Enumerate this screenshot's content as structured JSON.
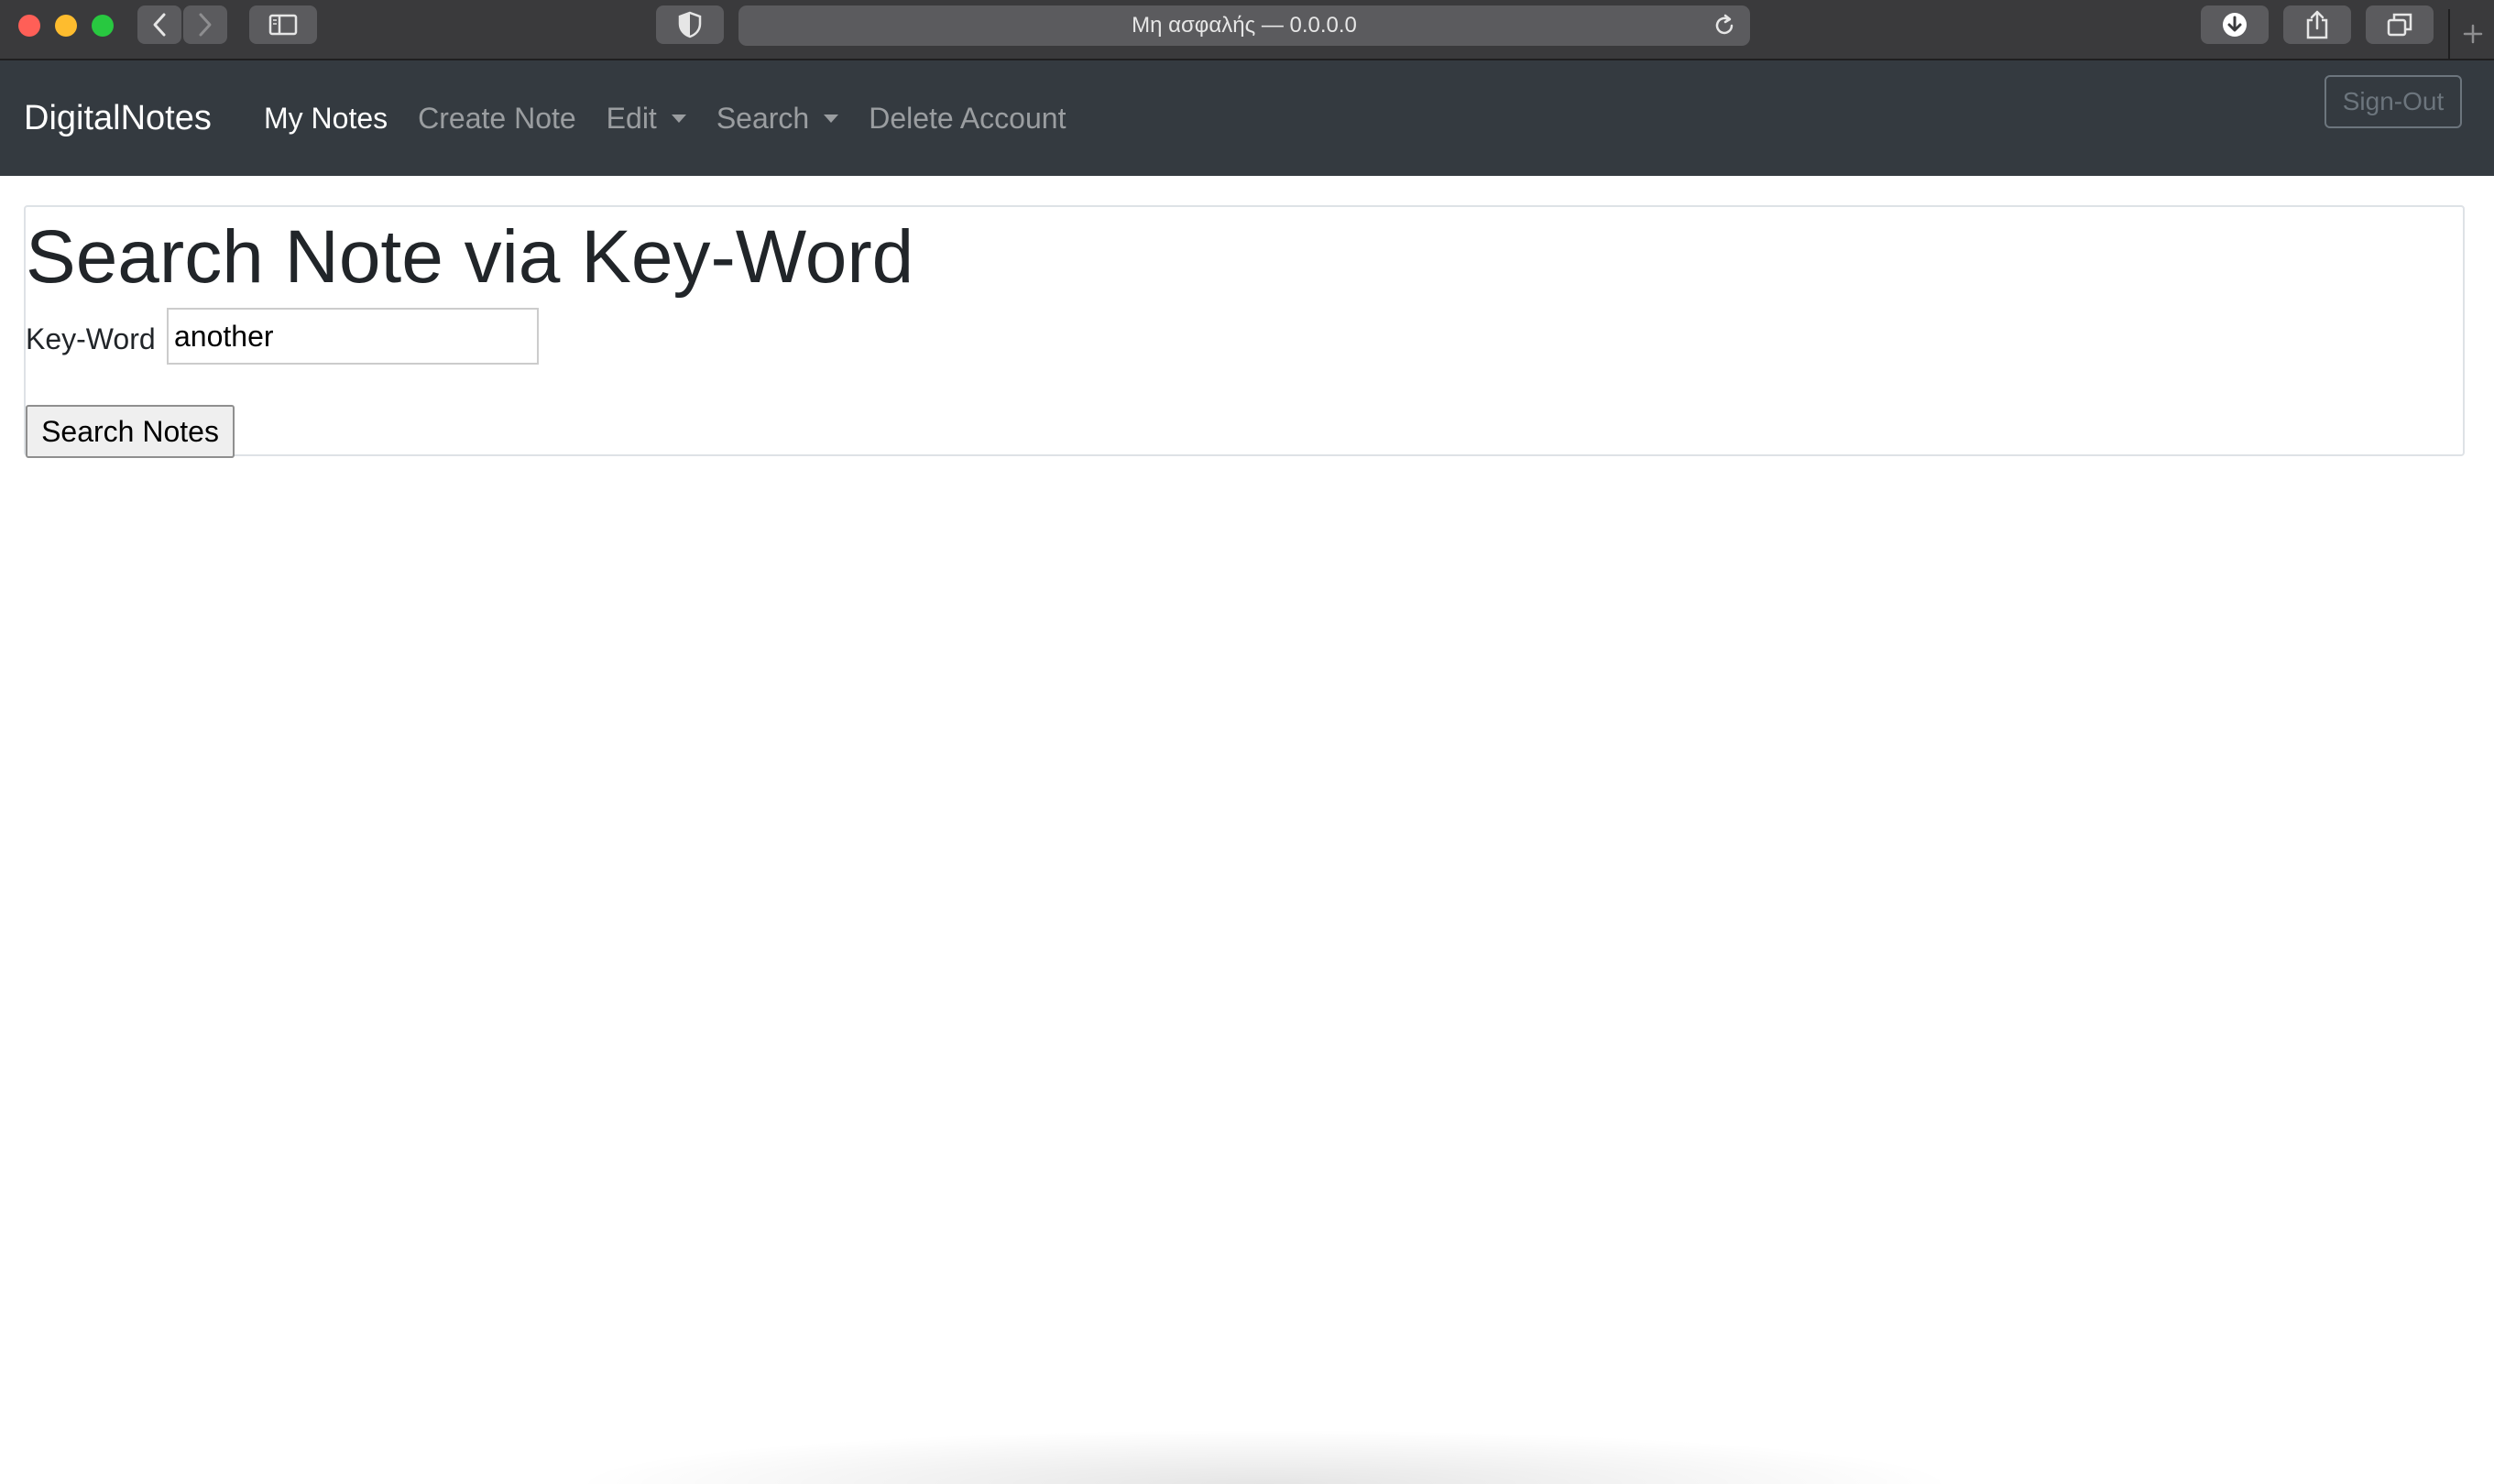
{
  "browser": {
    "address_text": "Μη ασφαλής — 0.0.0.0"
  },
  "navbar": {
    "brand": "DigitalNotes",
    "links": [
      {
        "label": "My Notes",
        "active": true
      },
      {
        "label": "Create Note"
      },
      {
        "label": "Edit",
        "dropdown": true
      },
      {
        "label": "Search",
        "dropdown": true
      },
      {
        "label": "Delete Account"
      }
    ],
    "signout_label": "Sign-Out"
  },
  "main": {
    "title": "Search Note via Key-Word",
    "keyword_label": "Key-Word",
    "keyword_value": "another",
    "submit_label": "Search Notes"
  },
  "colors": {
    "navbar_bg": "#343a40",
    "chrome_bg": "#3a3a3c"
  }
}
